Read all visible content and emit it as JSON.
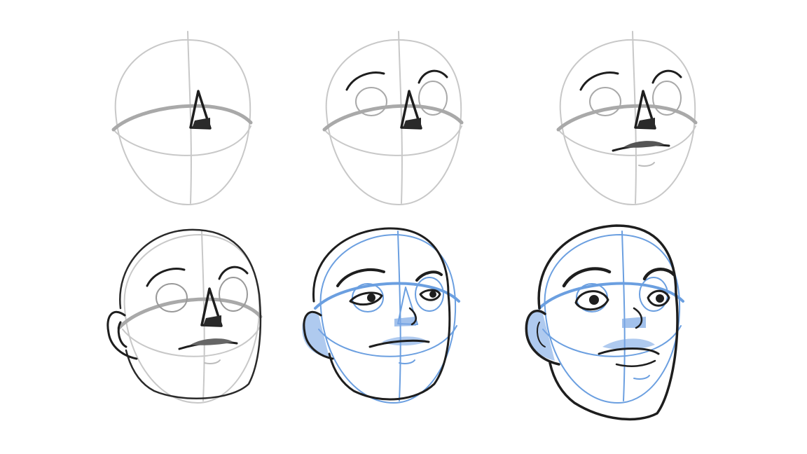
{
  "colors": {
    "background": "#ffffff",
    "guide": "#c8c8c8",
    "guide_dark": "#a9a9a9",
    "ink": "#1e1e1e",
    "blue": "#6b9fe0",
    "shade": "#2a2a2a"
  },
  "steps": [
    {
      "name": "step-1-nose"
    },
    {
      "name": "step-2-eye-sockets"
    },
    {
      "name": "step-3-mouth"
    },
    {
      "name": "step-4-ear-and-head"
    },
    {
      "name": "step-5-features"
    },
    {
      "name": "step-6-final"
    }
  ]
}
